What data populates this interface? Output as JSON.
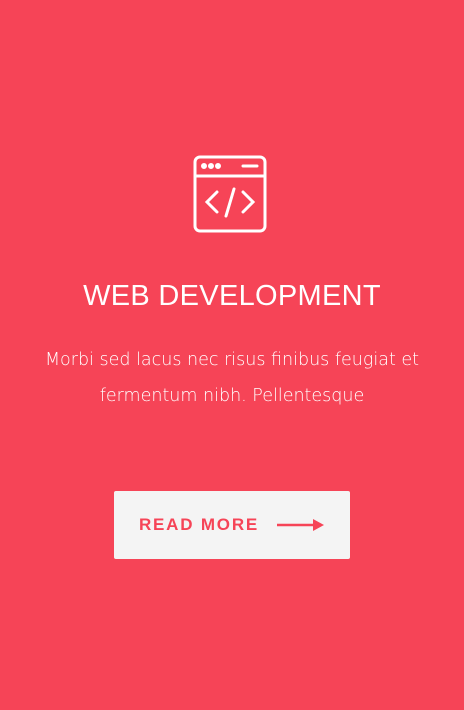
{
  "card": {
    "icon": "code-window-icon",
    "title": "WEB DEVELOPMENT",
    "description": "Morbi sed lacus nec risus finibus feugiat et fermentum nibh. Pellentesque",
    "button_label": "READ MORE",
    "accent": "#f64457"
  }
}
